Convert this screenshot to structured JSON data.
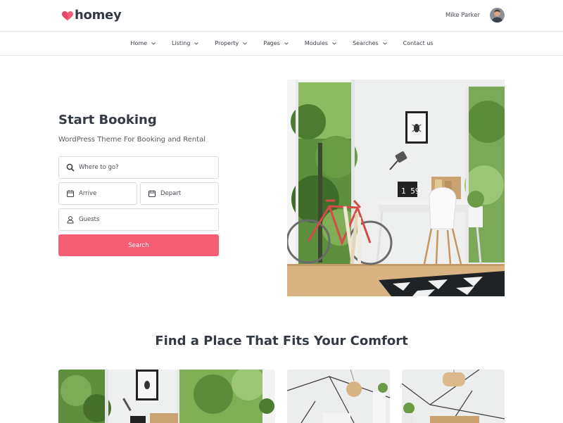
{
  "brand": {
    "name": "homey",
    "accent": "#f45e74"
  },
  "user": {
    "name": "Mike Parker"
  },
  "nav": {
    "items": [
      {
        "label": "Home",
        "dropdown": true
      },
      {
        "label": "Listing",
        "dropdown": true
      },
      {
        "label": "Property",
        "dropdown": true
      },
      {
        "label": "Pages",
        "dropdown": true
      },
      {
        "label": "Modules",
        "dropdown": true
      },
      {
        "label": "Searches",
        "dropdown": true
      },
      {
        "label": "Contact us",
        "dropdown": false
      }
    ]
  },
  "hero": {
    "title": "Start Booking",
    "subtitle": "WordPress Theme For Booking and Rental",
    "where_placeholder": "Where to go?",
    "arrive_placeholder": "Arrive",
    "depart_placeholder": "Depart",
    "guests_placeholder": "Guests",
    "search_label": "Search",
    "clock_text": "1 59"
  },
  "section": {
    "title": "Find a Place That Fits Your Comfort"
  },
  "icons": {
    "search": "search-icon",
    "calendar": "calendar-icon",
    "user": "user-icon",
    "chevron": "chevron-down-icon"
  }
}
